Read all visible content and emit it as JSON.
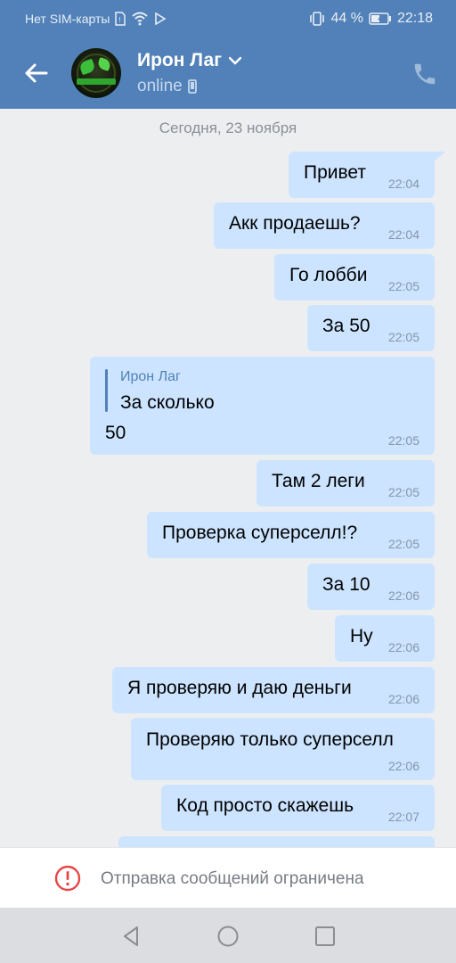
{
  "status_bar": {
    "carrier": "Нет SIM-карты",
    "battery": "44 %",
    "time": "22:18"
  },
  "header": {
    "contact_name": "Ирон Лаг",
    "status": "online"
  },
  "chat": {
    "date_label": "Сегодня, 23 ноября",
    "messages": [
      {
        "text": "Привет",
        "time": "22:04"
      },
      {
        "text": "Акк продаешь?",
        "time": "22:04"
      },
      {
        "text": "Го лобби",
        "time": "22:05"
      },
      {
        "text": "За 50",
        "time": "22:05"
      },
      {
        "reply_to_name": "Ирон Лаг",
        "reply_to_text": "За сколько",
        "text": "50",
        "time": "22:05"
      },
      {
        "text": "Там 2 леги",
        "time": "22:05"
      },
      {
        "text": "Проверка суперселл!?",
        "time": "22:05"
      },
      {
        "text": "За 10",
        "time": "22:06"
      },
      {
        "text": "Ну",
        "time": "22:06"
      },
      {
        "text": "Я проверяю и даю деньги",
        "time": "22:06"
      },
      {
        "text": "Проверяю только суперселл",
        "time": "22:06"
      },
      {
        "text": "Код просто скажешь",
        "time": "22:07"
      }
    ]
  },
  "footer": {
    "restriction_text": "Отправка сообщений ограничена"
  },
  "colors": {
    "header_bg": "#5181b8",
    "bubble_bg": "#cce4ff",
    "chat_bg": "#edeef0",
    "alert_red": "#e64646"
  },
  "icons": {
    "back": "arrow-left-icon",
    "dropdown": "chevron-down-icon",
    "device": "phone-device-icon",
    "call": "phone-call-icon",
    "alert": "exclamation-circle-icon",
    "nav_back": "triangle-back-icon",
    "nav_home": "circle-home-icon",
    "nav_recent": "square-recents-icon"
  }
}
